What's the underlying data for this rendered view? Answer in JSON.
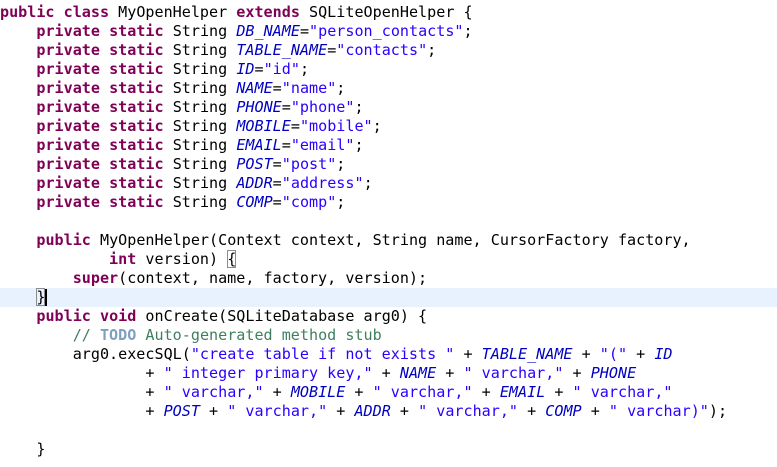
{
  "code": {
    "lines": [
      [
        [
          "kw",
          "public"
        ],
        [
          "p",
          " "
        ],
        [
          "kw",
          "class"
        ],
        [
          "p",
          " MyOpenHelper "
        ],
        [
          "kw",
          "extends"
        ],
        [
          "p",
          " SQLiteOpenHelper {"
        ]
      ],
      [
        [
          "p",
          "    "
        ],
        [
          "kw",
          "private"
        ],
        [
          "p",
          " "
        ],
        [
          "kw",
          "static"
        ],
        [
          "p",
          " String "
        ],
        [
          "fld",
          "DB_NAME"
        ],
        [
          "p",
          "="
        ],
        [
          "str",
          "\"person_contacts\""
        ],
        [
          "p",
          ";"
        ]
      ],
      [
        [
          "p",
          "    "
        ],
        [
          "kw",
          "private"
        ],
        [
          "p",
          " "
        ],
        [
          "kw",
          "static"
        ],
        [
          "p",
          " String "
        ],
        [
          "fld",
          "TABLE_NAME"
        ],
        [
          "p",
          "="
        ],
        [
          "str",
          "\"contacts\""
        ],
        [
          "p",
          ";"
        ]
      ],
      [
        [
          "p",
          "    "
        ],
        [
          "kw",
          "private"
        ],
        [
          "p",
          " "
        ],
        [
          "kw",
          "static"
        ],
        [
          "p",
          " String "
        ],
        [
          "fld",
          "ID"
        ],
        [
          "p",
          "="
        ],
        [
          "str",
          "\"id\""
        ],
        [
          "p",
          ";"
        ]
      ],
      [
        [
          "p",
          "    "
        ],
        [
          "kw",
          "private"
        ],
        [
          "p",
          " "
        ],
        [
          "kw",
          "static"
        ],
        [
          "p",
          " String "
        ],
        [
          "fld",
          "NAME"
        ],
        [
          "p",
          "="
        ],
        [
          "str",
          "\"name\""
        ],
        [
          "p",
          ";"
        ]
      ],
      [
        [
          "p",
          "    "
        ],
        [
          "kw",
          "private"
        ],
        [
          "p",
          " "
        ],
        [
          "kw",
          "static"
        ],
        [
          "p",
          " String "
        ],
        [
          "fld",
          "PHONE"
        ],
        [
          "p",
          "="
        ],
        [
          "str",
          "\"phone\""
        ],
        [
          "p",
          ";"
        ]
      ],
      [
        [
          "p",
          "    "
        ],
        [
          "kw",
          "private"
        ],
        [
          "p",
          " "
        ],
        [
          "kw",
          "static"
        ],
        [
          "p",
          " String "
        ],
        [
          "fld",
          "MOBILE"
        ],
        [
          "p",
          "="
        ],
        [
          "str",
          "\"mobile\""
        ],
        [
          "p",
          ";"
        ]
      ],
      [
        [
          "p",
          "    "
        ],
        [
          "kw",
          "private"
        ],
        [
          "p",
          " "
        ],
        [
          "kw",
          "static"
        ],
        [
          "p",
          " String "
        ],
        [
          "fld",
          "EMAIL"
        ],
        [
          "p",
          "="
        ],
        [
          "str",
          "\"email\""
        ],
        [
          "p",
          ";"
        ]
      ],
      [
        [
          "p",
          "    "
        ],
        [
          "kw",
          "private"
        ],
        [
          "p",
          " "
        ],
        [
          "kw",
          "static"
        ],
        [
          "p",
          " String "
        ],
        [
          "fld",
          "POST"
        ],
        [
          "p",
          "="
        ],
        [
          "str",
          "\"post\""
        ],
        [
          "p",
          ";"
        ]
      ],
      [
        [
          "p",
          "    "
        ],
        [
          "kw",
          "private"
        ],
        [
          "p",
          " "
        ],
        [
          "kw",
          "static"
        ],
        [
          "p",
          " String "
        ],
        [
          "fld",
          "ADDR"
        ],
        [
          "p",
          "="
        ],
        [
          "str",
          "\"address\""
        ],
        [
          "p",
          ";"
        ]
      ],
      [
        [
          "p",
          "    "
        ],
        [
          "kw",
          "private"
        ],
        [
          "p",
          " "
        ],
        [
          "kw",
          "static"
        ],
        [
          "p",
          " String "
        ],
        [
          "fld",
          "COMP"
        ],
        [
          "p",
          "="
        ],
        [
          "str",
          "\"comp\""
        ],
        [
          "p",
          ";"
        ]
      ],
      [],
      [
        [
          "p",
          "    "
        ],
        [
          "kw",
          "public"
        ],
        [
          "p",
          " MyOpenHelper(Context context, String name, CursorFactory factory,"
        ]
      ],
      [
        [
          "p",
          "            "
        ],
        [
          "kw",
          "int"
        ],
        [
          "p",
          " version) "
        ],
        [
          "bm",
          "{"
        ]
      ],
      [
        [
          "p",
          "        "
        ],
        [
          "kw",
          "super"
        ],
        [
          "p",
          "(context, name, factory, version);"
        ]
      ],
      [
        [
          "p",
          "    "
        ],
        [
          "bm",
          "}"
        ],
        [
          "caret",
          ""
        ]
      ],
      [
        [
          "p",
          "    "
        ],
        [
          "kw",
          "public"
        ],
        [
          "p",
          " "
        ],
        [
          "kw",
          "void"
        ],
        [
          "p",
          " onCreate(SQLiteDatabase arg0) {"
        ]
      ],
      [
        [
          "p",
          "        "
        ],
        [
          "cm",
          "// "
        ],
        [
          "todo",
          "TODO"
        ],
        [
          "cm",
          " Auto-generated method stub"
        ]
      ],
      [
        [
          "p",
          "        arg0.execSQL("
        ],
        [
          "str",
          "\"create table if not exists \""
        ],
        [
          "p",
          " + "
        ],
        [
          "fld",
          "TABLE_NAME"
        ],
        [
          "p",
          " + "
        ],
        [
          "str",
          "\"(\""
        ],
        [
          "p",
          " + "
        ],
        [
          "fld",
          "ID"
        ]
      ],
      [
        [
          "p",
          "                + "
        ],
        [
          "str",
          "\" integer primary key,\""
        ],
        [
          "p",
          " + "
        ],
        [
          "fld",
          "NAME"
        ],
        [
          "p",
          " + "
        ],
        [
          "str",
          "\" varchar,\""
        ],
        [
          "p",
          " + "
        ],
        [
          "fld",
          "PHONE"
        ]
      ],
      [
        [
          "p",
          "                + "
        ],
        [
          "str",
          "\" varchar,\""
        ],
        [
          "p",
          " + "
        ],
        [
          "fld",
          "MOBILE"
        ],
        [
          "p",
          " + "
        ],
        [
          "str",
          "\" varchar,\""
        ],
        [
          "p",
          " + "
        ],
        [
          "fld",
          "EMAIL"
        ],
        [
          "p",
          " + "
        ],
        [
          "str",
          "\" varchar,\""
        ]
      ],
      [
        [
          "p",
          "                + "
        ],
        [
          "fld",
          "POST"
        ],
        [
          "p",
          " + "
        ],
        [
          "str",
          "\" varchar,\""
        ],
        [
          "p",
          " + "
        ],
        [
          "fld",
          "ADDR"
        ],
        [
          "p",
          " + "
        ],
        [
          "str",
          "\" varchar,\""
        ],
        [
          "p",
          " + "
        ],
        [
          "fld",
          "COMP"
        ],
        [
          "p",
          " + "
        ],
        [
          "str",
          "\" varchar)\""
        ],
        [
          "p",
          ");"
        ]
      ],
      [],
      [
        [
          "p",
          "    }"
        ]
      ]
    ]
  }
}
